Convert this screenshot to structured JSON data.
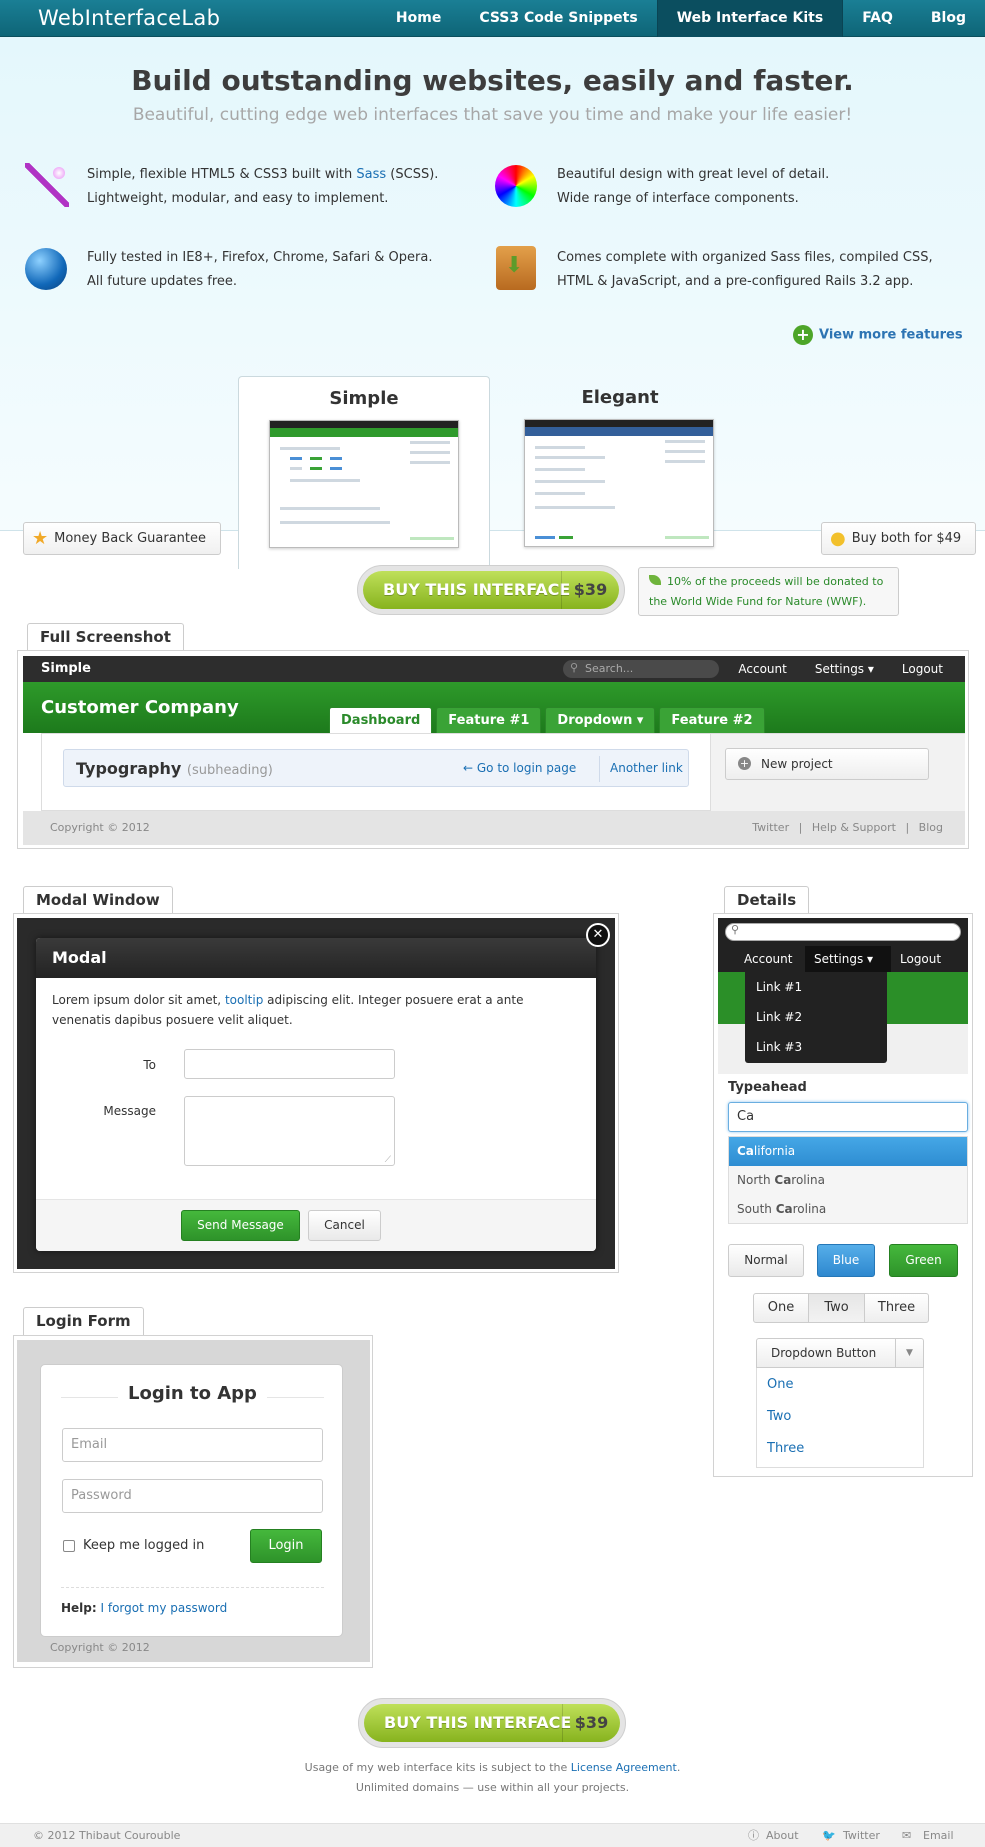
{
  "topnav": {
    "logo": "WebInterfaceLab",
    "items": [
      "Home",
      "CSS3 Code Snippets",
      "Web Interface Kits",
      "FAQ",
      "Blog"
    ]
  },
  "hero": {
    "title": "Build outstanding websites, easily and faster.",
    "subtitle": "Beautiful, cutting edge web interfaces that save you time and make your life easier!",
    "features": {
      "f1_line1_a": "Simple, flexible HTML5 & CSS3 built with ",
      "f1_link": "Sass",
      "f1_line1_b": " (SCSS).",
      "f1_line2": "Lightweight, modular, and easy to implement.",
      "f2_line1": "Beautiful design with great level of detail.",
      "f2_line2": "Wide range of interface components.",
      "f3_line1": "Fully tested in IE8+, Firefox, Chrome, Safari & Opera.",
      "f3_line2": "All future updates free.",
      "f4_line1": "Comes complete with organized Sass files, compiled CSS,",
      "f4_line2": "HTML & JavaScript, and a pre-configured Rails 3.2 app."
    },
    "more_features": "View more features",
    "tab_simple": "Simple",
    "tab_elegant": "Elegant",
    "money_back": "Money Back Guarantee",
    "buy_both": "Buy both for $49"
  },
  "buy": {
    "label": "BUY THIS INTERFACE",
    "price": "$39"
  },
  "donate": "10% of the proceeds will be donated to the World Wide Fund for Nature (WWF).",
  "full_screenshot": {
    "tab": "Full Screenshot",
    "brand": "Simple",
    "search_placeholder": "Search...",
    "nav": [
      "Account",
      "Settings ▾",
      "Logout"
    ],
    "company": "Customer Company",
    "tabs": [
      "Dashboard",
      "Feature #1",
      "Dropdown ▾",
      "Feature #2"
    ],
    "typo_title": "Typography",
    "typo_sub": "(subheading)",
    "link_login": "← Go to login page",
    "link_another": "Another link",
    "new_project": "New project",
    "copyright": "Copyright © 2012",
    "footer_links": [
      "Twitter",
      "Help & Support",
      "Blog"
    ]
  },
  "modal": {
    "tab": "Modal Window",
    "title": "Modal",
    "text_a": "Lorem ipsum dolor sit amet, ",
    "text_link": "tooltip",
    "text_b": " adipiscing elit. Integer posuere erat a ante venenatis dapibus posuere velit aliquet.",
    "to_label": "To",
    "message_label": "Message",
    "send": "Send Message",
    "cancel": "Cancel"
  },
  "details": {
    "tab": "Details",
    "nav": [
      "Account",
      "Settings ▾",
      "Logout"
    ],
    "menu": [
      "Link #1",
      "Link #2",
      "Link #3"
    ],
    "typeahead_label": "Typeahead",
    "typeahead_value": "Ca",
    "options": [
      {
        "pre": "Ca",
        "post": "lifornia"
      },
      {
        "pre": "North ",
        "bold": "Ca",
        "post": "rolina"
      },
      {
        "pre": "South ",
        "bold": "Ca",
        "post": "rolina"
      }
    ],
    "buttons": [
      "Normal",
      "Blue",
      "Green"
    ],
    "segments": [
      "One",
      "Two",
      "Three"
    ],
    "dropdown_label": "Dropdown Button",
    "dropdown_items": [
      "One",
      "Two",
      "Three"
    ]
  },
  "login": {
    "tab": "Login Form",
    "title": "Login to App",
    "email_placeholder": "Email",
    "password_placeholder": "Password",
    "keep": "Keep me logged in",
    "button": "Login",
    "help": "Help:",
    "forgot": "I forgot my password",
    "copyright": "Copyright © 2012"
  },
  "terms": {
    "line1_a": "Usage of my web interface kits is subject to the ",
    "line1_link": "License Agreement",
    "line1_b": ".",
    "line2": "Unlimited domains — use within all your projects."
  },
  "footer": {
    "copyright": "© 2012 Thibaut Courouble",
    "links": [
      "About",
      "Twitter",
      "Email"
    ]
  }
}
